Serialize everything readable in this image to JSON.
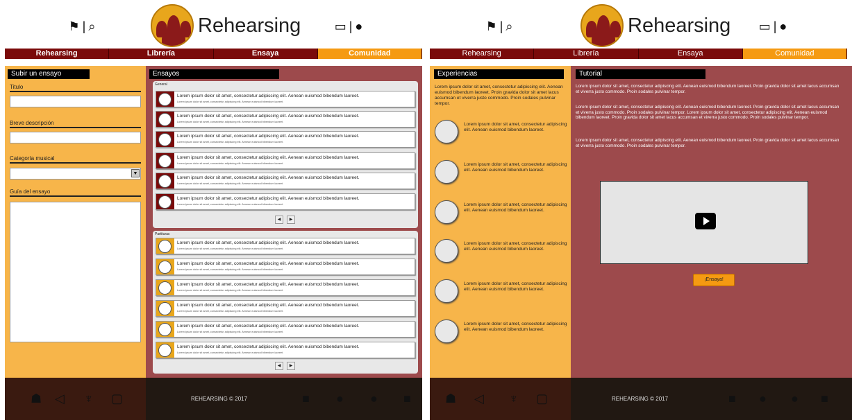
{
  "brand": {
    "name": "Rehearsing",
    "accent": "#f59a12",
    "dark_red": "#7a0a0a",
    "panel_bg": "#9d4a4c",
    "left_bg": "#f7b54a"
  },
  "nav": [
    "Rehearsing",
    "Librería",
    "Ensaya",
    "Comunidad"
  ],
  "icons": {
    "header_left": [
      "flag-icon",
      "search-icon"
    ],
    "header_right": [
      "inbox-icon",
      "user-icon"
    ],
    "footer_left": [
      "group-icon",
      "megaphone-icon",
      "microphone-icon",
      "chat-icon"
    ],
    "footer_right": [
      "twitter-icon",
      "youtube-icon",
      "spotify-icon",
      "facebook-icon"
    ]
  },
  "upload": {
    "title": "Subir un ensayo",
    "field_title": "Titulo",
    "field_desc": "Breve descripción",
    "field_cat": "Categoría musical",
    "field_guide": "Guía del ensayo"
  },
  "ensayos": {
    "title": "Ensayos",
    "general": {
      "label": "General",
      "rows": [
        {
          "line1": "Lorem ipsum dolor sit amet, consectetur adipiscing elit. Aenean euismod bibendum laoreet.",
          "line2": "Lorem ipsum dolor sit amet, consectetur adipiscing elit. Aenean euismod bibendum laoreet."
        },
        {
          "line1": "Lorem ipsum dolor sit amet, consectetur adipiscing elit. Aenean euismod bibendum laoreet.",
          "line2": "Lorem ipsum dolor sit amet, consectetur adipiscing elit. Aenean euismod bibendum laoreet."
        },
        {
          "line1": "Lorem ipsum dolor sit amet, consectetur adipiscing elit. Aenean euismod bibendum laoreet.",
          "line2": "Lorem ipsum dolor sit amet, consectetur adipiscing elit. Aenean euismod bibendum laoreet."
        },
        {
          "line1": "Lorem ipsum dolor sit amet, consectetur adipiscing elit. Aenean euismod bibendum laoreet.",
          "line2": "Lorem ipsum dolor sit amet, consectetur adipiscing elit. Aenean euismod bibendum laoreet."
        },
        {
          "line1": "Lorem ipsum dolor sit amet, consectetur adipiscing elit. Aenean euismod bibendum laoreet.",
          "line2": "Lorem ipsum dolor sit amet, consectetur adipiscing elit. Aenean euismod bibendum laoreet."
        },
        {
          "line1": "Lorem ipsum dolor sit amet, consectetur adipiscing elit. Aenean euismod bibendum laoreet.",
          "line2": "Lorem ipsum dolor sit amet, consectetur adipiscing elit. Aenean euismod bibendum laoreet."
        }
      ]
    },
    "partituras": {
      "label": "Partituras",
      "rows": [
        {
          "line1": "Lorem ipsum dolor sit amet, consectetur adipiscing elit. Aenean euismod bibendum laoreet.",
          "line2": "Lorem ipsum dolor sit amet, consectetur adipiscing elit. Aenean euismod bibendum laoreet."
        },
        {
          "line1": "Lorem ipsum dolor sit amet, consectetur adipiscing elit. Aenean euismod bibendum laoreet.",
          "line2": "Lorem ipsum dolor sit amet, consectetur adipiscing elit. Aenean euismod bibendum laoreet."
        },
        {
          "line1": "Lorem ipsum dolor sit amet, consectetur adipiscing elit. Aenean euismod bibendum laoreet.",
          "line2": "Lorem ipsum dolor sit amet, consectetur adipiscing elit. Aenean euismod bibendum laoreet."
        },
        {
          "line1": "Lorem ipsum dolor sit amet, consectetur adipiscing elit. Aenean euismod bibendum laoreet.",
          "line2": "Lorem ipsum dolor sit amet, consectetur adipiscing elit. Aenean euismod bibendum laoreet."
        },
        {
          "line1": "Lorem ipsum dolor sit amet, consectetur adipiscing elit. Aenean euismod bibendum laoreet.",
          "line2": "Lorem ipsum dolor sit amet, consectetur adipiscing elit. Aenean euismod bibendum laoreet."
        },
        {
          "line1": "Lorem ipsum dolor sit amet, consectetur adipiscing elit. Aenean euismod bibendum laoreet.",
          "line2": "Lorem ipsum dolor sit amet, consectetur adipiscing elit. Aenean euismod bibendum laoreet."
        }
      ]
    }
  },
  "experiencias": {
    "title": "Experiencias",
    "intro": "Lorem ipsum dolor sit amet, consectetur adipiscing elit. Aenean euismod bibendum laoreet. Proin gravida dolor sit amet lacus accumsan et viverra justo commodo. Proin sodales pulvinar tempor.",
    "items": [
      "Lorem ipsum dolor sit amet, consectetur adipiscing elit. Aenean euismod bibendum laoreet.",
      "Lorem ipsum dolor sit amet, consectetur adipiscing elit. Aenean euismod bibendum laoreet.",
      "Lorem ipsum dolor sit amet, consectetur adipiscing elit. Aenean euismod bibendum laoreet.",
      "Lorem ipsum dolor sit amet, consectetur adipiscing elit. Aenean euismod bibendum laoreet.",
      "Lorem ipsum dolor sit amet, consectetur adipiscing elit. Aenean euismod bibendum laoreet.",
      "Lorem ipsum dolor sit amet, consectetur adipiscing elit. Aenean euismod bibendum laoreet."
    ]
  },
  "tutorial": {
    "title": "Tutorial",
    "p1": "Lorem ipsum dolor sit amet, consectetur adipiscing elit. Aenean euismod bibendum laoreet. Proin gravida dolor sit amet lacus accumsan et viverra justo commodo. Proin sodales pulvinar tempor.",
    "p2": "Lorem ipsum dolor sit amet, consectetur adipiscing elit. Aenean euismod bibendum laoreet. Proin gravida dolor sit amet lacus accumsan et viverra justo commodo. Proin sodales pulvinar tempor. Lorem ipsum dolor sit amet, consectetur adipiscing elit. Aenean euismod bibendum laoreet. Proin gravida dolor sit amet lacus accumsan et viverra justo commodo. Proin sodales pulvinar tempor.",
    "p3": "Lorem ipsum dolor sit amet, consectetur adipiscing elit. Aenean euismod bibendum laoreet. Proin gravida dolor sit amet lacus accumsan et viverra justo commodo. Proin sodales pulvinar tempor.",
    "button": "¡Ensaya!"
  },
  "footer": {
    "copyright": "REHEARSING © 2017"
  }
}
